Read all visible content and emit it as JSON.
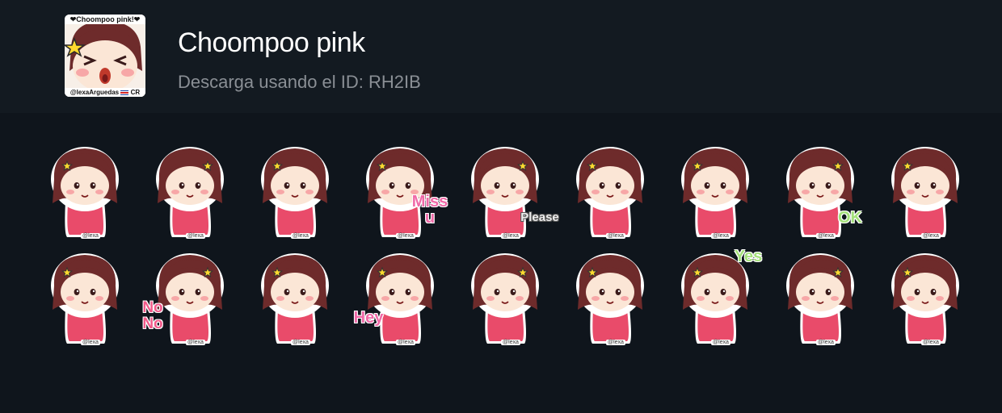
{
  "pack": {
    "title": "Choompoo pink",
    "subtitle": "Descarga usando el ID: RH2IB",
    "icon": {
      "top_text": "❤Choompoo pink!❤",
      "bottom_text": "@lexaArguedas",
      "bottom_suffix": "CR"
    }
  },
  "stickers": [
    {
      "row": 0,
      "pose": "crying-hug",
      "caption": "",
      "watermark": "@lexa"
    },
    {
      "row": 0,
      "pose": "arms-crossed-kiss",
      "caption": "",
      "watermark": "@lexa"
    },
    {
      "row": 0,
      "pose": "sitting-pout",
      "caption": "",
      "watermark": "@lexa"
    },
    {
      "row": 0,
      "pose": "miss-you",
      "caption": "Miss u",
      "watermark": "@lexa"
    },
    {
      "row": 0,
      "pose": "please",
      "caption": "Please",
      "watermark": "@lexa"
    },
    {
      "row": 0,
      "pose": "standing-pout",
      "caption": "",
      "watermark": "@lexa"
    },
    {
      "row": 0,
      "pose": "eating",
      "caption": "",
      "watermark": "@lexa"
    },
    {
      "row": 0,
      "pose": "ok",
      "caption": "OK",
      "watermark": "@lexa"
    },
    {
      "row": 0,
      "pose": "worried",
      "caption": "",
      "watermark": "@lexa"
    },
    {
      "row": 1,
      "pose": "sad",
      "caption": "",
      "watermark": "@lexa"
    },
    {
      "row": 1,
      "pose": "no-no",
      "caption": "No No",
      "watermark": "@lexa"
    },
    {
      "row": 1,
      "pose": "shy-hands",
      "caption": "",
      "watermark": "@lexa"
    },
    {
      "row": 1,
      "pose": "hey",
      "caption": "Hey",
      "watermark": "@lexa"
    },
    {
      "row": 1,
      "pose": "thinking",
      "caption": "",
      "watermark": "@lexa"
    },
    {
      "row": 1,
      "pose": "annoyed",
      "caption": "",
      "watermark": "@lexa"
    },
    {
      "row": 1,
      "pose": "yes-wink",
      "caption": "Yes",
      "watermark": "@lexa"
    },
    {
      "row": 1,
      "pose": "laughing",
      "caption": "",
      "watermark": "@lexa"
    },
    {
      "row": 1,
      "pose": "happy-cry",
      "caption": "",
      "watermark": "@lexa"
    }
  ],
  "colors": {
    "hair": "#6e2b2b",
    "skin": "#fbe6d6",
    "dress": "#e94b6a",
    "star": "#ffd92e",
    "blush": "#f7a7a7"
  }
}
